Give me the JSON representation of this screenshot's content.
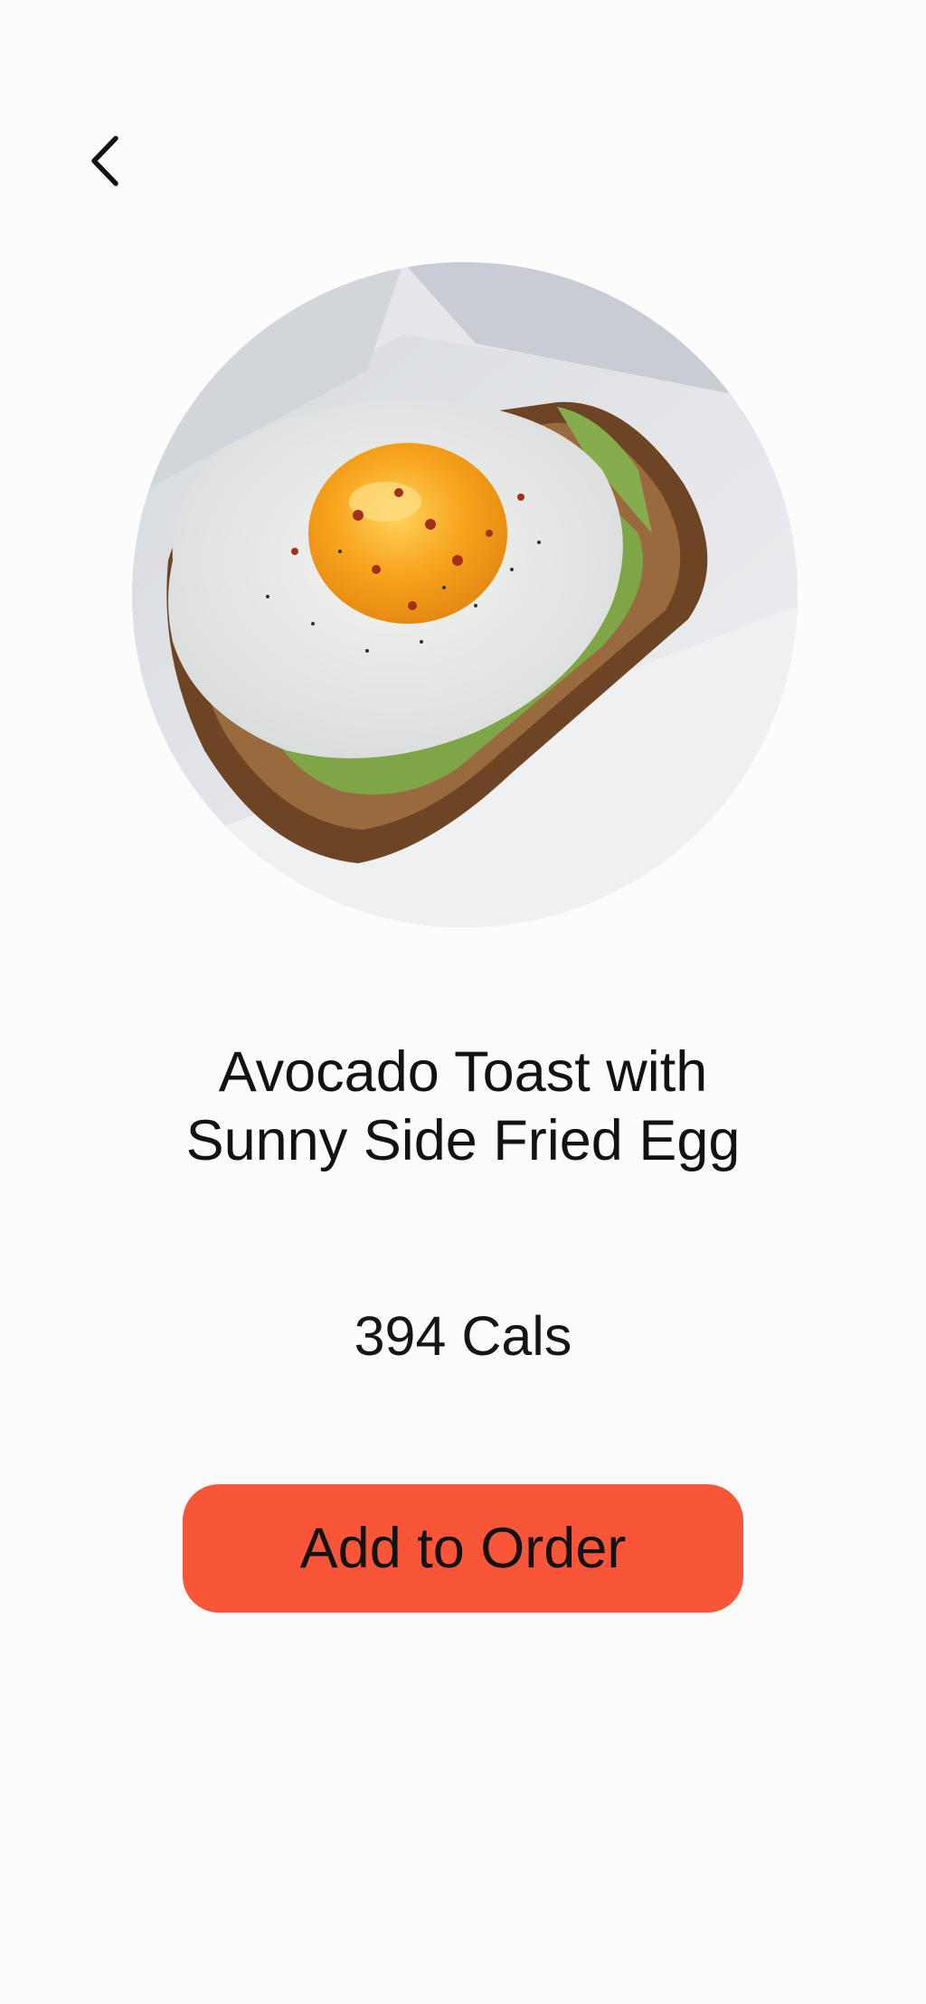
{
  "nav": {
    "back_icon": "chevron-left-icon"
  },
  "product": {
    "image_icon": "food-photo",
    "title_line1": "Avocado Toast with",
    "title_line2": "Sunny Side Fried Egg",
    "calories": "394 Cals"
  },
  "actions": {
    "add_label": "Add to Order"
  },
  "colors": {
    "accent": "#f95639",
    "background": "#fcfcfc",
    "text": "#121212"
  }
}
